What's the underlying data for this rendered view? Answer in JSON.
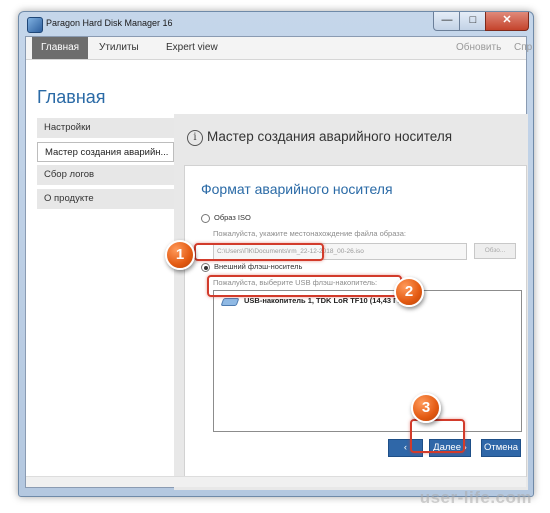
{
  "window": {
    "title": "Paragon Hard Disk Manager 16",
    "minimize": "—",
    "maximize": "□",
    "close": "✕"
  },
  "menu": {
    "tabs": [
      "Главная",
      "Утилиты",
      "Expert view"
    ],
    "right_items": [
      "Обновить",
      "Спр"
    ]
  },
  "page_title": "Главная",
  "sidebar": {
    "items": [
      {
        "label": "Настройки"
      },
      {
        "label": "Мастер создания аварийн..."
      },
      {
        "label": "Сбор логов"
      },
      {
        "label": "О продукте"
      }
    ],
    "selected_index": 1
  },
  "wizard": {
    "info_icon": "i",
    "title": "Мастер создания аварийного носителя",
    "card_title": "Формат аварийного носителя",
    "option_iso": "Образ ISO",
    "iso_hint": "Пожалуйста, укажите местонахождение файла образа:",
    "iso_path": "C:\\Users\\ПК\\Documents\\rm_22-12-2018_00-26.iso",
    "browse_label": "Обзо...",
    "option_usb": "Внешний флэш-носитель",
    "usb_hint": "Пожалуйста, выберите USB флэш-накопитель:",
    "usb_devices": [
      "USB-накопитель 1, TDK LoR TF10 (14,43 ГБ)"
    ],
    "selected_option": "usb",
    "buttons": {
      "back": "‹ Назад",
      "next": "Далее ›",
      "cancel": "Отмена"
    }
  },
  "annotations": {
    "steps": [
      "1",
      "2",
      "3"
    ],
    "color": "#e35a12"
  },
  "watermark": "user-life.com"
}
